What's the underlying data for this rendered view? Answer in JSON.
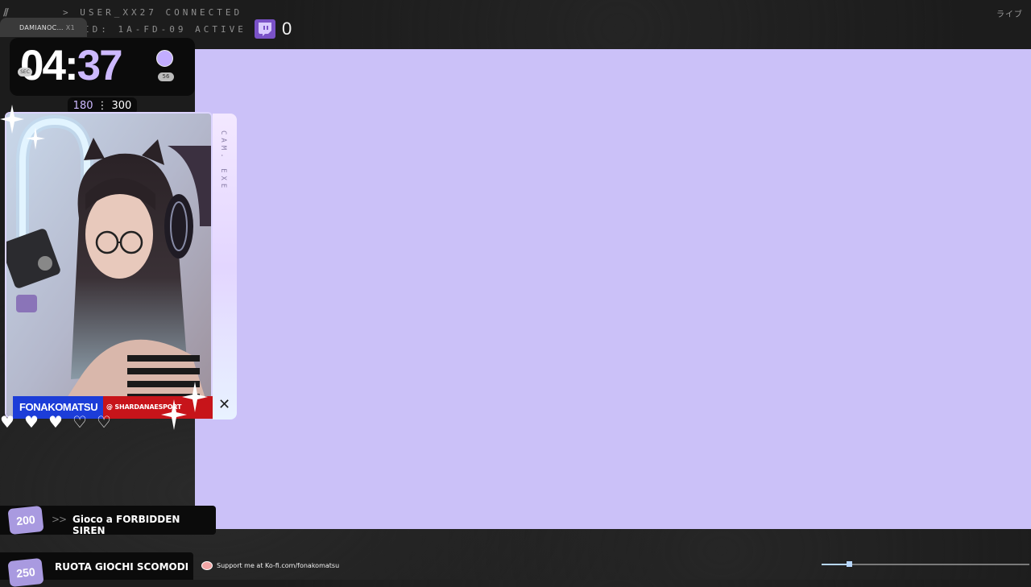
{
  "hud": {
    "line1": "> USER_XX27 CONNECTED",
    "line2": "ID: 1A-FD-09 ACTIVE",
    "sub_count": "0",
    "jp_tag": "ライブ"
  },
  "timer": {
    "streamer_tab": "DAMIANOC…",
    "streamer_tab_suffix": "X1",
    "minutes": "04",
    "colon": ":",
    "seconds": "37",
    "badge_right": "56",
    "badge_left": "SEC",
    "goal_current": "180",
    "goal_separator": "⋮",
    "goal_target": "300"
  },
  "camera": {
    "side_label": "CAM. EXE",
    "streamer_name": "FONAKOMATSU",
    "handle": "@ SHARDANAESPORT",
    "hearts_filled": 3,
    "hearts_total": 5
  },
  "rewards": [
    {
      "points": "200",
      "label": "Gioco a FORBIDDEN SIREN"
    },
    {
      "points": "250",
      "label": "RUOTA GIOCHI SCOMODI"
    }
  ],
  "kofi": {
    "text": "Support me at Ko-fi.com/fonakomatsu"
  },
  "media_progress": 0.13,
  "colors": {
    "accent": "#cdb9ff",
    "game_area": "#cbc1f8",
    "name_blue": "#1c3dd8",
    "name_red": "#c7141a",
    "badge": "#a99ae0"
  }
}
